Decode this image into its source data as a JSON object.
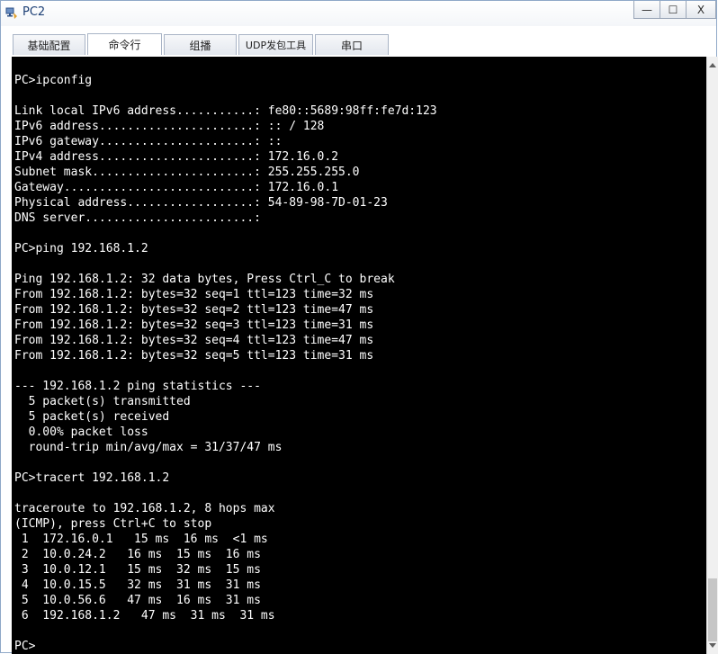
{
  "window": {
    "title": "PC2",
    "minimize": "—",
    "maximize": "☐",
    "close": "X"
  },
  "tabs": [
    {
      "label": "基础配置",
      "active": false
    },
    {
      "label": "命令行",
      "active": true
    },
    {
      "label": "组播",
      "active": false
    },
    {
      "label": "UDP发包工具",
      "active": false
    },
    {
      "label": "串口",
      "active": false
    }
  ],
  "terminal": {
    "lines": [
      "PC>ipconfig",
      "",
      "Link local IPv6 address...........: fe80::5689:98ff:fe7d:123",
      "IPv6 address......................: :: / 128",
      "IPv6 gateway......................: ::",
      "IPv4 address......................: 172.16.0.2",
      "Subnet mask.......................: 255.255.255.0",
      "Gateway...........................: 172.16.0.1",
      "Physical address..................: 54-89-98-7D-01-23",
      "DNS server........................:",
      "",
      "PC>ping 192.168.1.2",
      "",
      "Ping 192.168.1.2: 32 data bytes, Press Ctrl_C to break",
      "From 192.168.1.2: bytes=32 seq=1 ttl=123 time=32 ms",
      "From 192.168.1.2: bytes=32 seq=2 ttl=123 time=47 ms",
      "From 192.168.1.2: bytes=32 seq=3 ttl=123 time=31 ms",
      "From 192.168.1.2: bytes=32 seq=4 ttl=123 time=47 ms",
      "From 192.168.1.2: bytes=32 seq=5 ttl=123 time=31 ms",
      "",
      "--- 192.168.1.2 ping statistics ---",
      "  5 packet(s) transmitted",
      "  5 packet(s) received",
      "  0.00% packet loss",
      "  round-trip min/avg/max = 31/37/47 ms",
      "",
      "PC>tracert 192.168.1.2",
      "",
      "traceroute to 192.168.1.2, 8 hops max",
      "(ICMP), press Ctrl+C to stop",
      " 1  172.16.0.1   15 ms  16 ms  <1 ms",
      " 2  10.0.24.2   16 ms  15 ms  16 ms",
      " 3  10.0.12.1   15 ms  32 ms  15 ms",
      " 4  10.0.15.5   32 ms  31 ms  31 ms",
      " 5  10.0.56.6   47 ms  16 ms  31 ms",
      " 6  192.168.1.2   47 ms  31 ms  31 ms",
      "",
      "PC>"
    ]
  },
  "colors": {
    "terminal_bg": "#000000",
    "terminal_fg": "#ffffff",
    "title_color": "#1c3f75"
  },
  "icons": {
    "app": "pc-app-icon",
    "scroll_up": "arrow-up-icon",
    "scroll_down": "arrow-down-icon"
  }
}
